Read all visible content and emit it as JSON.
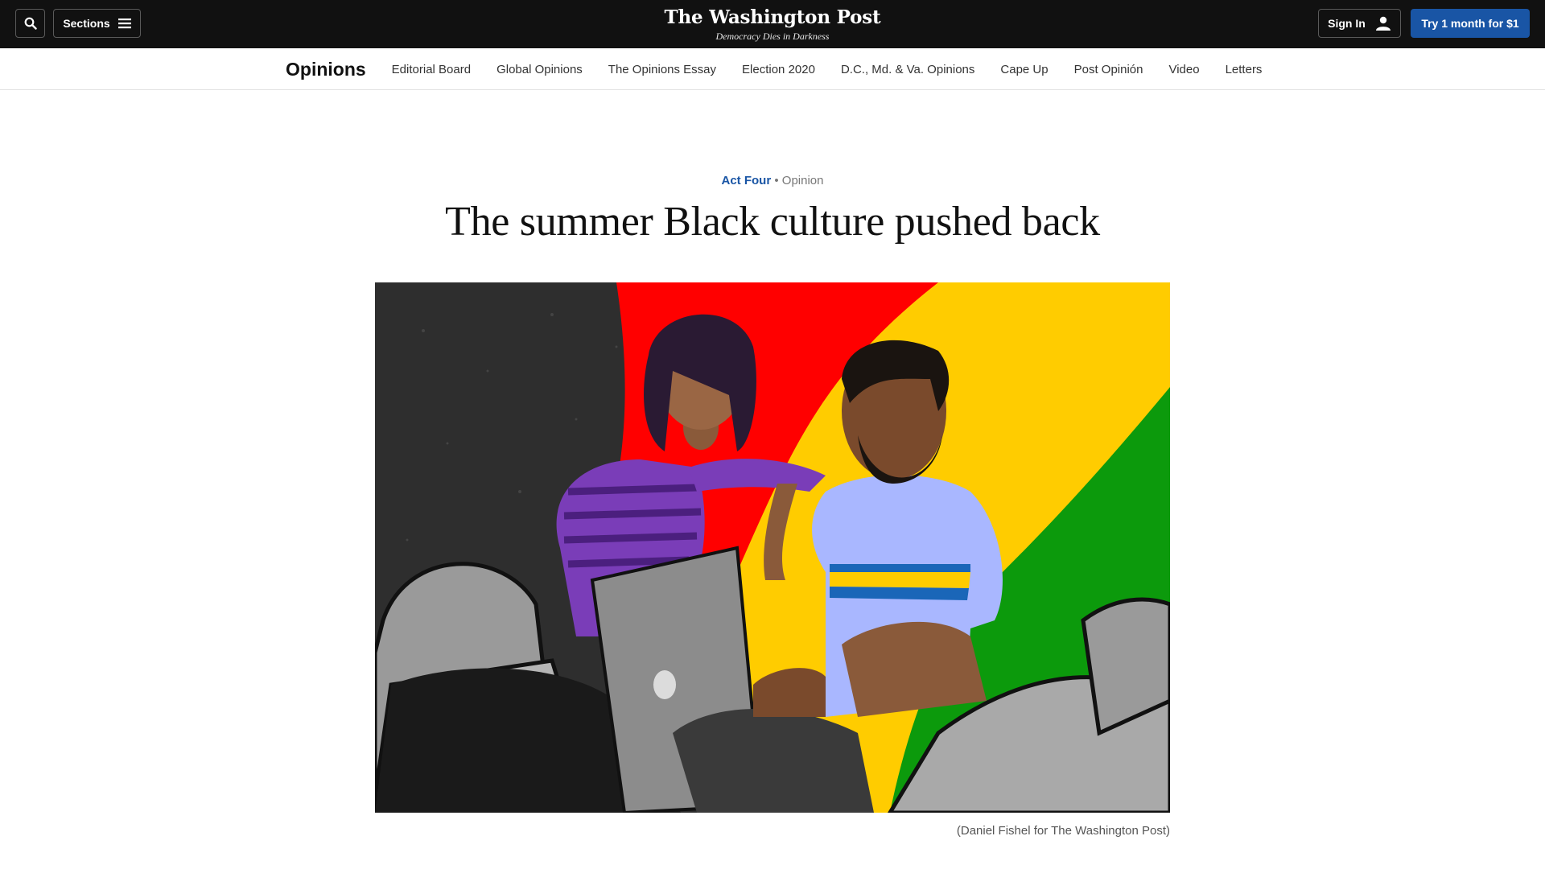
{
  "header": {
    "sections_label": "Sections",
    "logo_text": "The Washington Post",
    "tagline": "Democracy Dies in Darkness",
    "signin_label": "Sign In",
    "trial_label": "Try 1 month for $1",
    "icons": [
      "search-icon",
      "menu-icon",
      "user-icon"
    ]
  },
  "section_nav": {
    "title": "Opinions",
    "links": [
      "Editorial Board",
      "Global Opinions",
      "The Opinions Essay",
      "Election 2020",
      "D.C., Md. & Va. Opinions",
      "Cape Up",
      "Post Opinión",
      "Video",
      "Letters"
    ]
  },
  "article": {
    "kicker": "Act Four",
    "kicker_separator": "•",
    "label": "Opinion",
    "headline": "The summer Black culture pushed back",
    "image_caption": "(Daniel Fishel for The Washington Post)"
  },
  "colors": {
    "topbar": "#111111",
    "accent_blue": "#1955a5",
    "red": "#ff0000",
    "yellow": "#ffcc00",
    "green": "#0c9a0c",
    "art_background": "#2e2e2e"
  }
}
